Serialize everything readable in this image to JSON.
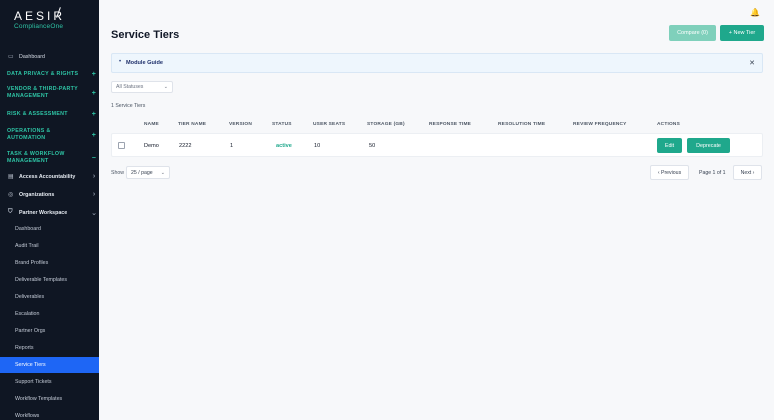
{
  "app": {
    "brand": "AESIR",
    "brand_sub": "ComplianceOne"
  },
  "sidebar": {
    "dashboard": "Dashboard",
    "sections": [
      {
        "label": "DATA PRIVACY & RIGHTS",
        "indicator": "+"
      },
      {
        "label": "VENDOR & THIRD-PARTY MANAGEMENT",
        "indicator": "+"
      },
      {
        "label": "RISK & ASSESSMENT",
        "indicator": "+"
      },
      {
        "label": "OPERATIONS & AUTOMATION",
        "indicator": "+"
      },
      {
        "label": "TASK & WORKFLOW MANAGEMENT",
        "indicator": "−"
      }
    ],
    "groups": [
      {
        "label": "Access Accountability",
        "indicator": "›"
      },
      {
        "label": "Organizations",
        "indicator": "›"
      },
      {
        "label": "Partner Workspace",
        "indicator": "⌄"
      }
    ],
    "subitems": [
      "Dashboard",
      "Audit Trail",
      "Brand Profiles",
      "Deliverable Templates",
      "Deliverables",
      "Escalation",
      "Partner Orgs",
      "Reports",
      "Service Tiers",
      "Support Tickets",
      "Workflow Templates",
      "Workflows"
    ],
    "active_subitem": "Service Tiers"
  },
  "header": {
    "title": "Service Tiers",
    "compare_label": "Compare (0)",
    "new_label": "+ New Tier"
  },
  "guide": {
    "bullet": "•",
    "label": "Module Guide",
    "close": "✕"
  },
  "filter": {
    "status_value": "All Statuses"
  },
  "summary": {
    "count_text": "1 Service Tiers"
  },
  "table": {
    "headers": [
      "NAME",
      "TIER NAME",
      "VERSION",
      "STATUS",
      "USER SEATS",
      "STORAGE (GB)",
      "RESPONSE TIME",
      "RESOLUTION TIME",
      "REVIEW FREQUENCY",
      "ACTIONS"
    ],
    "rows": [
      {
        "name": "Demo",
        "tier_name": "2222",
        "version": "1",
        "status": "active",
        "user_seats": "10",
        "storage": "50",
        "response_time": "",
        "resolution_time": "",
        "review_frequency": "",
        "edit_label": "Edit",
        "deprecate_label": "Deprecate"
      }
    ]
  },
  "pagination": {
    "show_label": "Show",
    "page_size": "25 / page",
    "prev_label": "‹ Previous",
    "page_info": "Page 1 of 1",
    "next_label": "Next ›"
  },
  "colors": {
    "sidebar_bg": "#0f1623",
    "accent": "#1fa88c",
    "active_nav": "#1e66f5"
  }
}
